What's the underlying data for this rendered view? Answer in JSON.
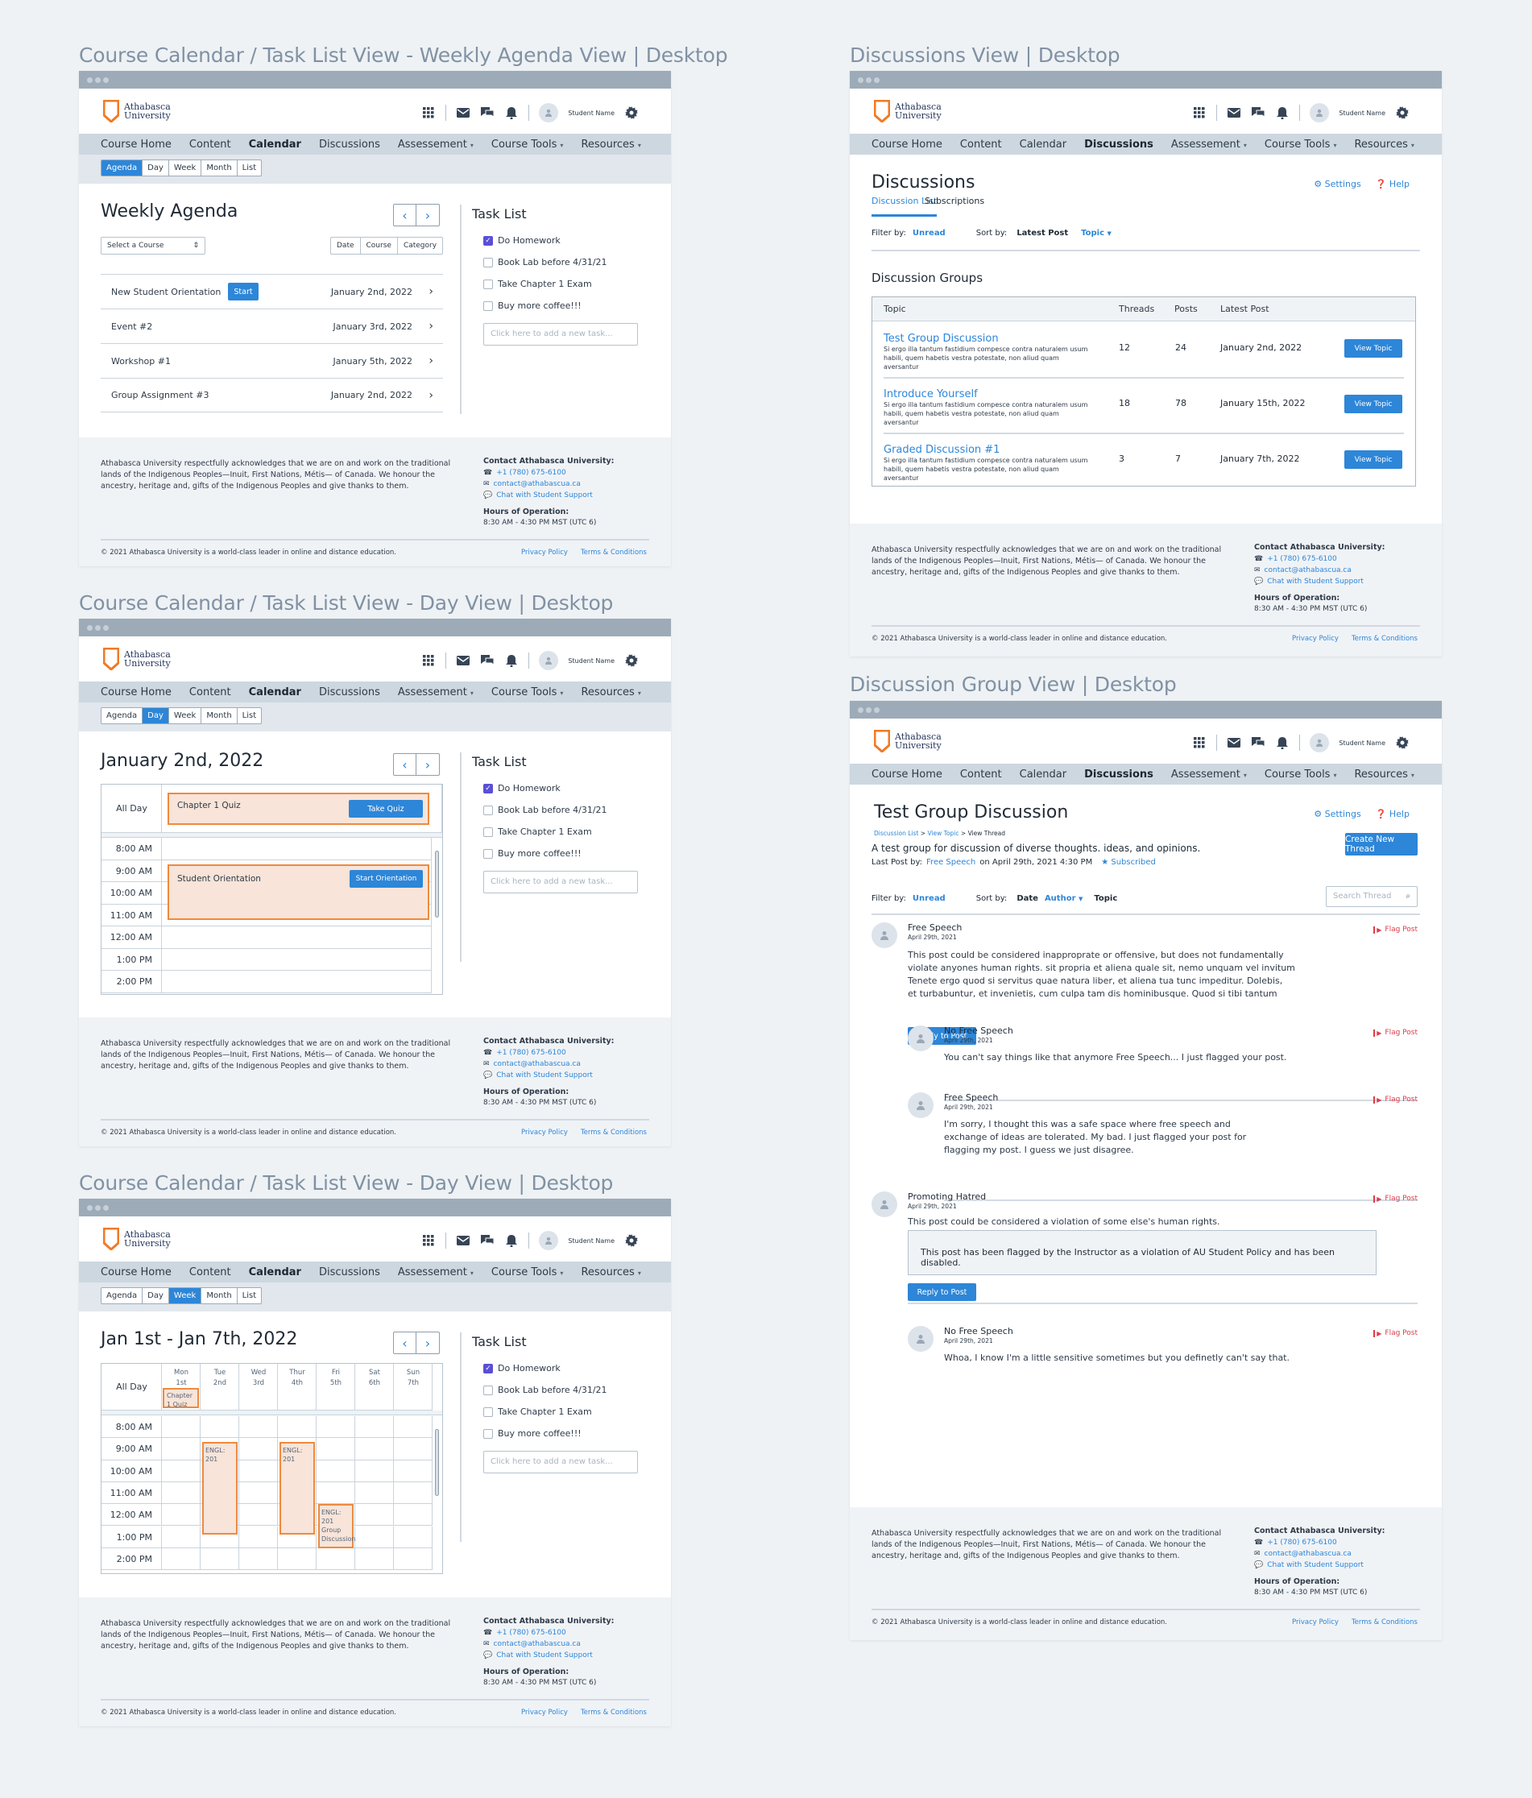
{
  "section_titles": {
    "agenda": "Course Calendar / Task List View - Weekly Agenda View | Desktop",
    "day": "Course Calendar / Task List View - Day View | Desktop",
    "week": "Course Calendar / Task List View - Day View | Desktop",
    "discussions": "Discussions View | Desktop",
    "group": "Discussion Group View | Desktop"
  },
  "brand": {
    "line1": "Athabasca",
    "line2": "University",
    "accent": "#f07a25",
    "primary": "#2d86d8"
  },
  "header": {
    "student_name": "Student Name"
  },
  "nav": {
    "items": [
      "Course Home",
      "Content",
      "Calendar",
      "Discussions",
      "Assessement",
      "Course Tools",
      "Resources"
    ],
    "caret": "▾"
  },
  "view_tabs": [
    "Agenda",
    "Day",
    "Week",
    "Month",
    "List"
  ],
  "agenda": {
    "title": "Weekly Agenda",
    "select_course": "Select a Course",
    "filters": [
      "Date",
      "Course",
      "Category"
    ],
    "rows": [
      {
        "title": "New Student Orientation",
        "button": "Start",
        "date": "January 2nd, 2022"
      },
      {
        "title": "Event #2",
        "date": "January 3rd, 2022"
      },
      {
        "title": "Workshop #1",
        "date": "January 5th, 2022"
      },
      {
        "title": "Group Assignment #3",
        "date": "January 2nd, 2022"
      }
    ]
  },
  "tasks": {
    "title": "Task List",
    "items": [
      {
        "label": "Do Homework",
        "checked": true
      },
      {
        "label": "Book Lab before 4/31/21",
        "checked": false
      },
      {
        "label": "Take Chapter 1 Exam",
        "checked": false
      },
      {
        "label": "Buy more coffee!!!",
        "checked": false
      }
    ],
    "placeholder": "Click here to add a new task..."
  },
  "day": {
    "title": "January 2nd, 2022",
    "all_day": "All Day",
    "times": [
      "8:00 AM",
      "9:00 AM",
      "10:00 AM",
      "11:00 AM",
      "12:00 AM",
      "1:00 PM",
      "2:00 PM"
    ],
    "quiz": {
      "title": "Chapter 1 Quiz",
      "button": "Take Quiz"
    },
    "orientation": {
      "title": "Student Orientation",
      "button": "Start Orientation"
    }
  },
  "week": {
    "title": "Jan 1st - Jan 7th, 2022",
    "days": [
      {
        "d": "Mon",
        "n": "1st"
      },
      {
        "d": "Tue",
        "n": "2nd"
      },
      {
        "d": "Wed",
        "n": "3rd"
      },
      {
        "d": "Thur",
        "n": "4th"
      },
      {
        "d": "Fri",
        "n": "5th"
      },
      {
        "d": "Sat",
        "n": "6th"
      },
      {
        "d": "Sun",
        "n": "7th"
      }
    ],
    "allday_event": "Chapter 1 Quiz",
    "events": [
      "ENGL: 201",
      "ENGL: 201",
      "ENGL: 201 Group Discussion"
    ]
  },
  "footer": {
    "ack": "Athabasca University respectfully acknowledges that we are on and work on the traditional lands of the Indigenous Peoples—Inuit, First Nations, Métis— of Canada. We honour the ancestry, heritage and, gifts of the Indigenous Peoples and give thanks to them.",
    "contact_title": "Contact Athabasca University:",
    "phone": "+1 (780) 675-6100",
    "email": "contact@athabascua.ca",
    "chat": "Chat with Student Support",
    "hours_title": "Hours of Operation:",
    "hours": "8:30 AM - 4:30 PM MST (UTC 6)",
    "copyright": "© 2021 Athabasca University is a world-class leader in online and distance education.",
    "privacy": "Privacy Policy",
    "terms": "Terms & Conditions"
  },
  "discussions": {
    "title": "Discussions",
    "settings": "Settings",
    "help": "Help",
    "tabs": [
      "Discussion List",
      "Subscriptions"
    ],
    "filter_label": "Filter by:",
    "filter_value": "Unread",
    "sort_label": "Sort by:",
    "sort_latest": "Latest Post",
    "sort_topic": "Topic",
    "groups_title": "Discussion Groups",
    "columns": [
      "Topic",
      "Threads",
      "Posts",
      "Latest Post"
    ],
    "rows": [
      {
        "title": "Test Group Discussion",
        "desc": "Si ergo illa tantum fastidium compesce contra naturalem usum habili, quem habetis vestra potestate, non aliud quam aversantur",
        "threads": "12",
        "posts": "24",
        "latest": "January 2nd, 2022",
        "button": "View Topic"
      },
      {
        "title": "Introduce Yourself",
        "desc": "Si ergo illa tantum fastidium compesce contra naturalem usum habili, quem habetis vestra potestate, non aliud quam aversantur",
        "threads": "18",
        "posts": "78",
        "latest": "January 15th, 2022",
        "button": "View Topic"
      },
      {
        "title": "Graded Discussion #1",
        "desc": "Si ergo illa tantum fastidium compesce contra naturalem usum habili, quem habetis vestra potestate, non aliud quam aversantur",
        "threads": "3",
        "posts": "7",
        "latest": "January 7th, 2022",
        "button": "View Topic"
      }
    ]
  },
  "group": {
    "title": "Test Group Discussion",
    "breadcrumb": [
      "Discussion List",
      "View Topic",
      "View Thread"
    ],
    "description": "A test group for discussion of diverse thoughts. ideas, and opinions.",
    "last_post_label": "Last Post by:",
    "last_post_author": "Free Speech",
    "last_post_when": "on April 29th, 2021 4:30 PM",
    "subscribed": "Subscribed",
    "create_button": "Create New Thread",
    "sort_date": "Date",
    "sort_author": "Author",
    "sort_topic": "Topic",
    "search_placeholder": "Search Thread",
    "flag": "Flag Post",
    "reply": "Reply to Post",
    "posts": [
      {
        "author": "Free Speech",
        "date": "April 29th, 2021",
        "lines": [
          "This post could be considered inapproprate or offensive, but does not fundamentally",
          "violate anyones human rights. sit propria et aliena quale sit, nemo unquam vel invitum",
          "Tenete ergo quod si servitus quae natura liber, et aliena tua tunc impeditur. Dolebis,",
          "et turbabuntur, et invenietis, cum culpa tam dis hominibusque. Quod si tibi tantum"
        ]
      },
      {
        "author": "No Free Speech",
        "date": "April 29th, 2021",
        "lines": [
          "You can't say things like that anymore Free Speech... I just flagged your post."
        ]
      },
      {
        "author": "Free Speech",
        "date": "April 29th, 2021",
        "lines": [
          "I'm sorry, I thought this was a safe space where free speech and",
          "exchange of ideas are tolerated. My bad. I just flagged your post for",
          "flagging my post. I guess we just disagree."
        ]
      },
      {
        "author": "Promoting Hatred",
        "date": "April 29th, 2021",
        "lines": [
          "This post could be considered a violation of some else's human rights."
        ],
        "notice": "This post has been flagged by the Instructor as a violation of AU Student Policy and has been disabled."
      },
      {
        "author": "No Free Speech",
        "date": "April 29th, 2021",
        "lines": [
          "Whoa, I know I'm a little sensitive sometimes but you definetly can't say that."
        ]
      }
    ]
  }
}
